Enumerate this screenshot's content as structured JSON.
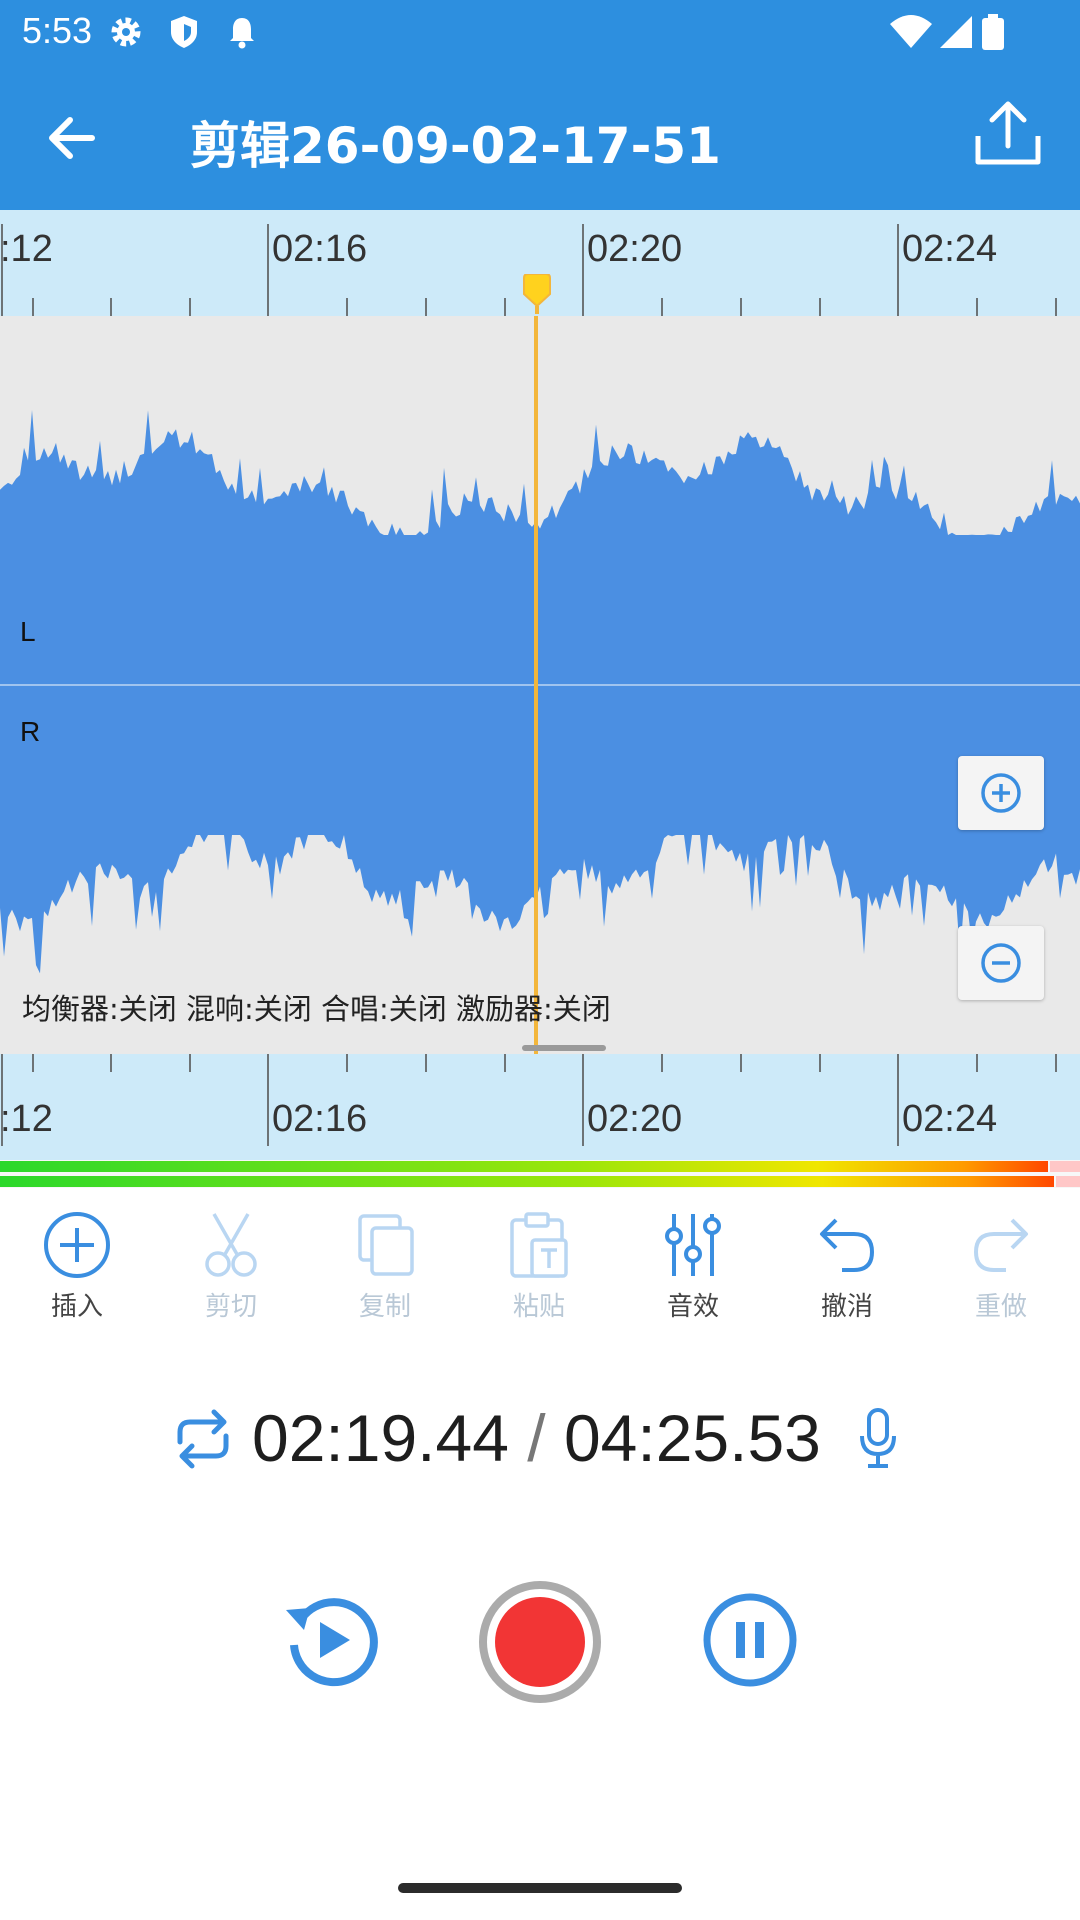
{
  "status_bar": {
    "time": "5:53",
    "icons": [
      "settings-icon",
      "shield-icon",
      "notification-bell-icon",
      "wifi-icon",
      "cellular-signal-icon",
      "battery-icon"
    ]
  },
  "app_bar": {
    "title": "剪辑26-09-02-17-51",
    "back_icon": "arrow-left-icon",
    "share_icon": "share-upload-icon",
    "color": "#2d8fdf"
  },
  "timeline": {
    "tick_labels": [
      ":12",
      "02:16",
      "02:20",
      "02:24"
    ],
    "playhead_color": "#f3b63b",
    "ruler_color": "#cdeaf9"
  },
  "waveform": {
    "channel_left_label": "L",
    "channel_right_label": "R",
    "wave_color": "#4b8fe2",
    "effects_status": "均衡器:关闭 混响:关闭 合唱:关闭 激励器:关闭",
    "zoom_in_icon": "zoom-in-plus-icon",
    "zoom_out_icon": "zoom-out-minus-icon"
  },
  "toolbar": {
    "items": [
      {
        "label": "插入",
        "icon": "insert-plus-circle-icon",
        "enabled": true
      },
      {
        "label": "剪切",
        "icon": "scissors-icon",
        "enabled": false
      },
      {
        "label": "复制",
        "icon": "copy-icon",
        "enabled": false
      },
      {
        "label": "粘贴",
        "icon": "paste-clipboard-icon",
        "enabled": false
      },
      {
        "label": "音效",
        "icon": "equalizer-sliders-icon",
        "enabled": true
      },
      {
        "label": "撤消",
        "icon": "undo-icon",
        "enabled": true
      },
      {
        "label": "重做",
        "icon": "redo-icon",
        "enabled": false
      }
    ]
  },
  "playback": {
    "current_time": "02:19.44",
    "separator": "/",
    "total_time": "04:25.53",
    "loop_icon": "loop-repeat-icon",
    "mic_icon": "microphone-icon"
  },
  "transport": {
    "replay_icon": "replay-icon",
    "record_icon": "record-icon",
    "pause_icon": "pause-icon",
    "record_color": "#f23535",
    "accent_color": "#3a8ee0"
  }
}
